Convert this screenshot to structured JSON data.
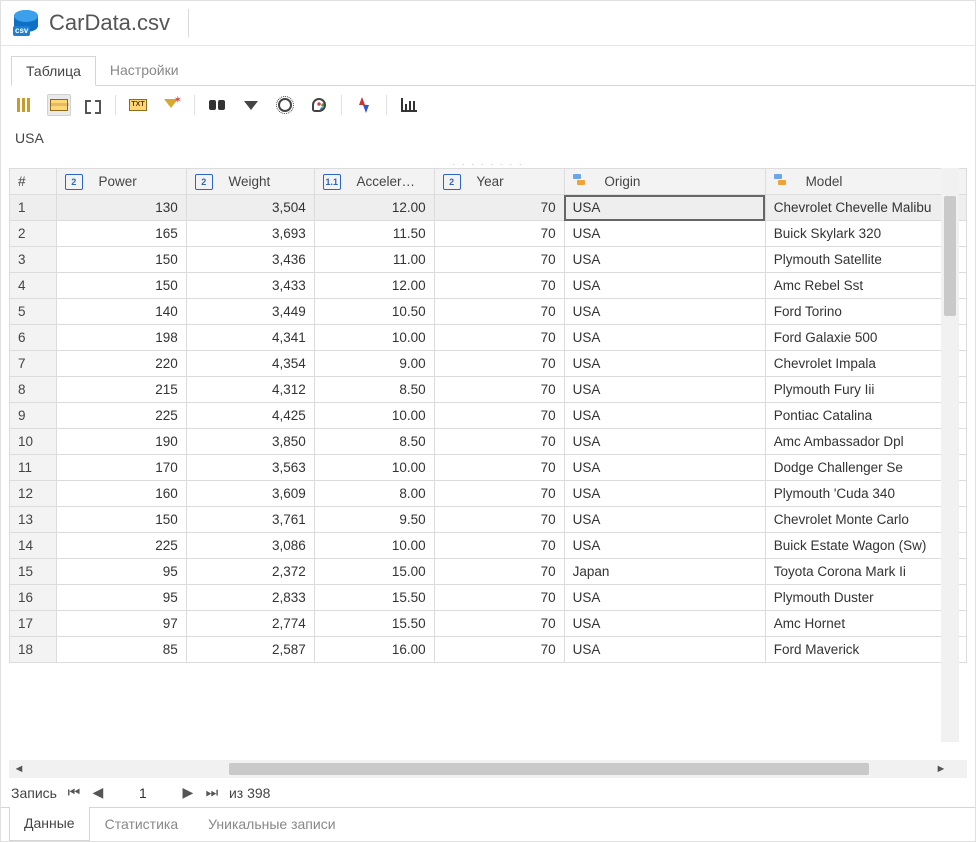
{
  "title": "CarData.csv",
  "csv_badge": "csv",
  "upper_tabs": {
    "table": "Таблица",
    "settings": "Настройки"
  },
  "txt_badge": "TXT",
  "cell_preview": "USA",
  "int_badge": "2",
  "float_badge": "1.1",
  "columns": {
    "rownum": "#",
    "power": "Power",
    "weight": "Weight",
    "accel": "Acceler…",
    "year": "Year",
    "origin": "Origin",
    "model": "Model"
  },
  "rows": [
    {
      "n": "1",
      "power": "130",
      "weight": "3,504",
      "accel": "12.00",
      "year": "70",
      "origin": "USA",
      "model": "Chevrolet Chevelle Malibu"
    },
    {
      "n": "2",
      "power": "165",
      "weight": "3,693",
      "accel": "11.50",
      "year": "70",
      "origin": "USA",
      "model": "Buick Skylark 320"
    },
    {
      "n": "3",
      "power": "150",
      "weight": "3,436",
      "accel": "11.00",
      "year": "70",
      "origin": "USA",
      "model": "Plymouth Satellite"
    },
    {
      "n": "4",
      "power": "150",
      "weight": "3,433",
      "accel": "12.00",
      "year": "70",
      "origin": "USA",
      "model": "Amc Rebel Sst"
    },
    {
      "n": "5",
      "power": "140",
      "weight": "3,449",
      "accel": "10.50",
      "year": "70",
      "origin": "USA",
      "model": "Ford Torino"
    },
    {
      "n": "6",
      "power": "198",
      "weight": "4,341",
      "accel": "10.00",
      "year": "70",
      "origin": "USA",
      "model": "Ford Galaxie 500"
    },
    {
      "n": "7",
      "power": "220",
      "weight": "4,354",
      "accel": "9.00",
      "year": "70",
      "origin": "USA",
      "model": "Chevrolet Impala"
    },
    {
      "n": "8",
      "power": "215",
      "weight": "4,312",
      "accel": "8.50",
      "year": "70",
      "origin": "USA",
      "model": "Plymouth Fury Iii"
    },
    {
      "n": "9",
      "power": "225",
      "weight": "4,425",
      "accel": "10.00",
      "year": "70",
      "origin": "USA",
      "model": "Pontiac Catalina"
    },
    {
      "n": "10",
      "power": "190",
      "weight": "3,850",
      "accel": "8.50",
      "year": "70",
      "origin": "USA",
      "model": "Amc Ambassador Dpl"
    },
    {
      "n": "11",
      "power": "170",
      "weight": "3,563",
      "accel": "10.00",
      "year": "70",
      "origin": "USA",
      "model": "Dodge Challenger Se"
    },
    {
      "n": "12",
      "power": "160",
      "weight": "3,609",
      "accel": "8.00",
      "year": "70",
      "origin": "USA",
      "model": "Plymouth 'Cuda 340"
    },
    {
      "n": "13",
      "power": "150",
      "weight": "3,761",
      "accel": "9.50",
      "year": "70",
      "origin": "USA",
      "model": "Chevrolet Monte Carlo"
    },
    {
      "n": "14",
      "power": "225",
      "weight": "3,086",
      "accel": "10.00",
      "year": "70",
      "origin": "USA",
      "model": "Buick Estate Wagon (Sw)"
    },
    {
      "n": "15",
      "power": "95",
      "weight": "2,372",
      "accel": "15.00",
      "year": "70",
      "origin": "Japan",
      "model": "Toyota Corona Mark Ii"
    },
    {
      "n": "16",
      "power": "95",
      "weight": "2,833",
      "accel": "15.50",
      "year": "70",
      "origin": "USA",
      "model": "Plymouth Duster"
    },
    {
      "n": "17",
      "power": "97",
      "weight": "2,774",
      "accel": "15.50",
      "year": "70",
      "origin": "USA",
      "model": "Amc Hornet"
    },
    {
      "n": "18",
      "power": "85",
      "weight": "2,587",
      "accel": "16.00",
      "year": "70",
      "origin": "USA",
      "model": "Ford Maverick"
    }
  ],
  "pager": {
    "label": "Запись",
    "current": "1",
    "total_prefix": "из",
    "total": "398"
  },
  "bottom_tabs": {
    "data": "Данные",
    "stats": "Статистика",
    "unique": "Уникальные записи"
  }
}
